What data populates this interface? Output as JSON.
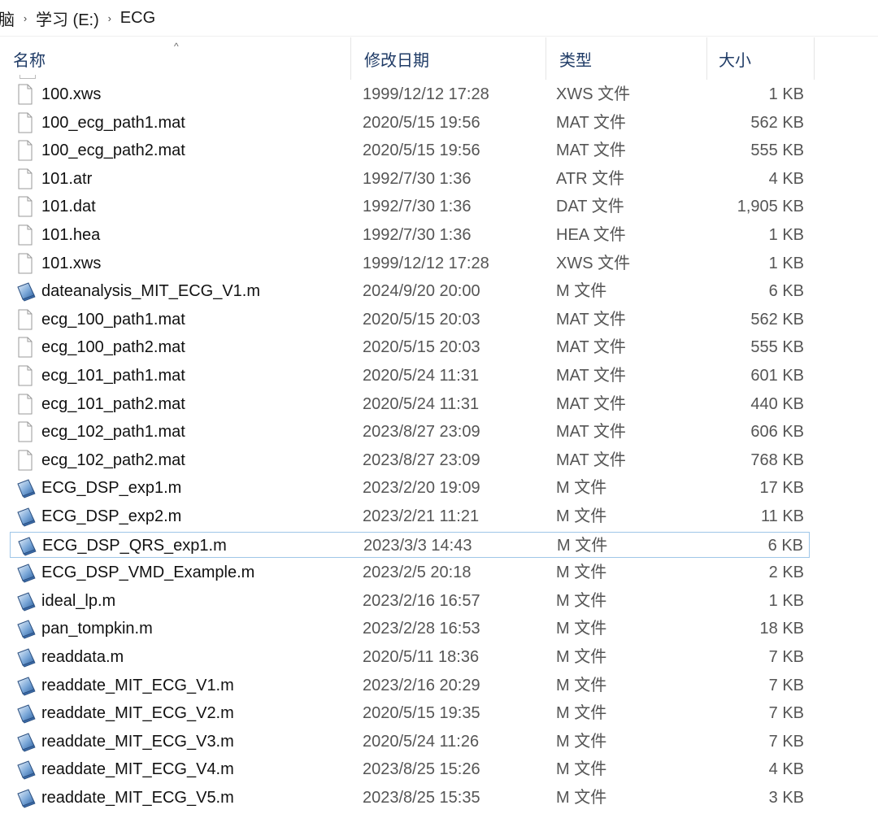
{
  "breadcrumb": {
    "items": [
      "脑",
      "学习 (E:)",
      "ECG"
    ],
    "separator": "›"
  },
  "columns": {
    "name": "名称",
    "date": "修改日期",
    "type": "类型",
    "size": "大小",
    "sort_indicator": "^"
  },
  "files": [
    {
      "name": "100.xws",
      "date": "1999/12/12 17:28",
      "type": "XWS 文件",
      "size": "1 KB",
      "icon": "document-icon"
    },
    {
      "name": "100_ecg_path1.mat",
      "date": "2020/5/15 19:56",
      "type": "MAT 文件",
      "size": "562 KB",
      "icon": "document-icon"
    },
    {
      "name": "100_ecg_path2.mat",
      "date": "2020/5/15 19:56",
      "type": "MAT 文件",
      "size": "555 KB",
      "icon": "document-icon"
    },
    {
      "name": "101.atr",
      "date": "1992/7/30 1:36",
      "type": "ATR 文件",
      "size": "4 KB",
      "icon": "document-icon"
    },
    {
      "name": "101.dat",
      "date": "1992/7/30 1:36",
      "type": "DAT 文件",
      "size": "1,905 KB",
      "icon": "document-icon"
    },
    {
      "name": "101.hea",
      "date": "1992/7/30 1:36",
      "type": "HEA 文件",
      "size": "1 KB",
      "icon": "document-icon"
    },
    {
      "name": "101.xws",
      "date": "1999/12/12 17:28",
      "type": "XWS 文件",
      "size": "1 KB",
      "icon": "document-icon"
    },
    {
      "name": "dateanalysis_MIT_ECG_V1.m",
      "date": "2024/9/20 20:00",
      "type": "M 文件",
      "size": "6 KB",
      "icon": "matlab-file-icon"
    },
    {
      "name": "ecg_100_path1.mat",
      "date": "2020/5/15 20:03",
      "type": "MAT 文件",
      "size": "562 KB",
      "icon": "document-icon"
    },
    {
      "name": "ecg_100_path2.mat",
      "date": "2020/5/15 20:03",
      "type": "MAT 文件",
      "size": "555 KB",
      "icon": "document-icon"
    },
    {
      "name": "ecg_101_path1.mat",
      "date": "2020/5/24 11:31",
      "type": "MAT 文件",
      "size": "601 KB",
      "icon": "document-icon"
    },
    {
      "name": "ecg_101_path2.mat",
      "date": "2020/5/24 11:31",
      "type": "MAT 文件",
      "size": "440 KB",
      "icon": "document-icon"
    },
    {
      "name": "ecg_102_path1.mat",
      "date": "2023/8/27 23:09",
      "type": "MAT 文件",
      "size": "606 KB",
      "icon": "document-icon"
    },
    {
      "name": "ecg_102_path2.mat",
      "date": "2023/8/27 23:09",
      "type": "MAT 文件",
      "size": "768 KB",
      "icon": "document-icon"
    },
    {
      "name": "ECG_DSP_exp1.m",
      "date": "2023/2/20 19:09",
      "type": "M 文件",
      "size": "17 KB",
      "icon": "matlab-file-icon"
    },
    {
      "name": "ECG_DSP_exp2.m",
      "date": "2023/2/21 11:21",
      "type": "M 文件",
      "size": "11 KB",
      "icon": "matlab-file-icon"
    },
    {
      "name": "ECG_DSP_QRS_exp1.m",
      "date": "2023/3/3 14:43",
      "type": "M 文件",
      "size": "6 KB",
      "icon": "matlab-file-icon",
      "selected": true
    },
    {
      "name": "ECG_DSP_VMD_Example.m",
      "date": "2023/2/5 20:18",
      "type": "M 文件",
      "size": "2 KB",
      "icon": "matlab-file-icon"
    },
    {
      "name": "ideal_lp.m",
      "date": "2023/2/16 16:57",
      "type": "M 文件",
      "size": "1 KB",
      "icon": "matlab-file-icon"
    },
    {
      "name": "pan_tompkin.m",
      "date": "2023/2/28 16:53",
      "type": "M 文件",
      "size": "18 KB",
      "icon": "matlab-file-icon"
    },
    {
      "name": "readdata.m",
      "date": "2020/5/11 18:36",
      "type": "M 文件",
      "size": "7 KB",
      "icon": "matlab-file-icon"
    },
    {
      "name": "readdate_MIT_ECG_V1.m",
      "date": "2023/2/16 20:29",
      "type": "M 文件",
      "size": "7 KB",
      "icon": "matlab-file-icon"
    },
    {
      "name": "readdate_MIT_ECG_V2.m",
      "date": "2020/5/15 19:35",
      "type": "M 文件",
      "size": "7 KB",
      "icon": "matlab-file-icon"
    },
    {
      "name": "readdate_MIT_ECG_V3.m",
      "date": "2020/5/24 11:26",
      "type": "M 文件",
      "size": "7 KB",
      "icon": "matlab-file-icon"
    },
    {
      "name": "readdate_MIT_ECG_V4.m",
      "date": "2023/8/25 15:26",
      "type": "M 文件",
      "size": "4 KB",
      "icon": "matlab-file-icon"
    },
    {
      "name": "readdate_MIT_ECG_V5.m",
      "date": "2023/8/25 15:35",
      "type": "M 文件",
      "size": "3 KB",
      "icon": "matlab-file-icon"
    }
  ]
}
